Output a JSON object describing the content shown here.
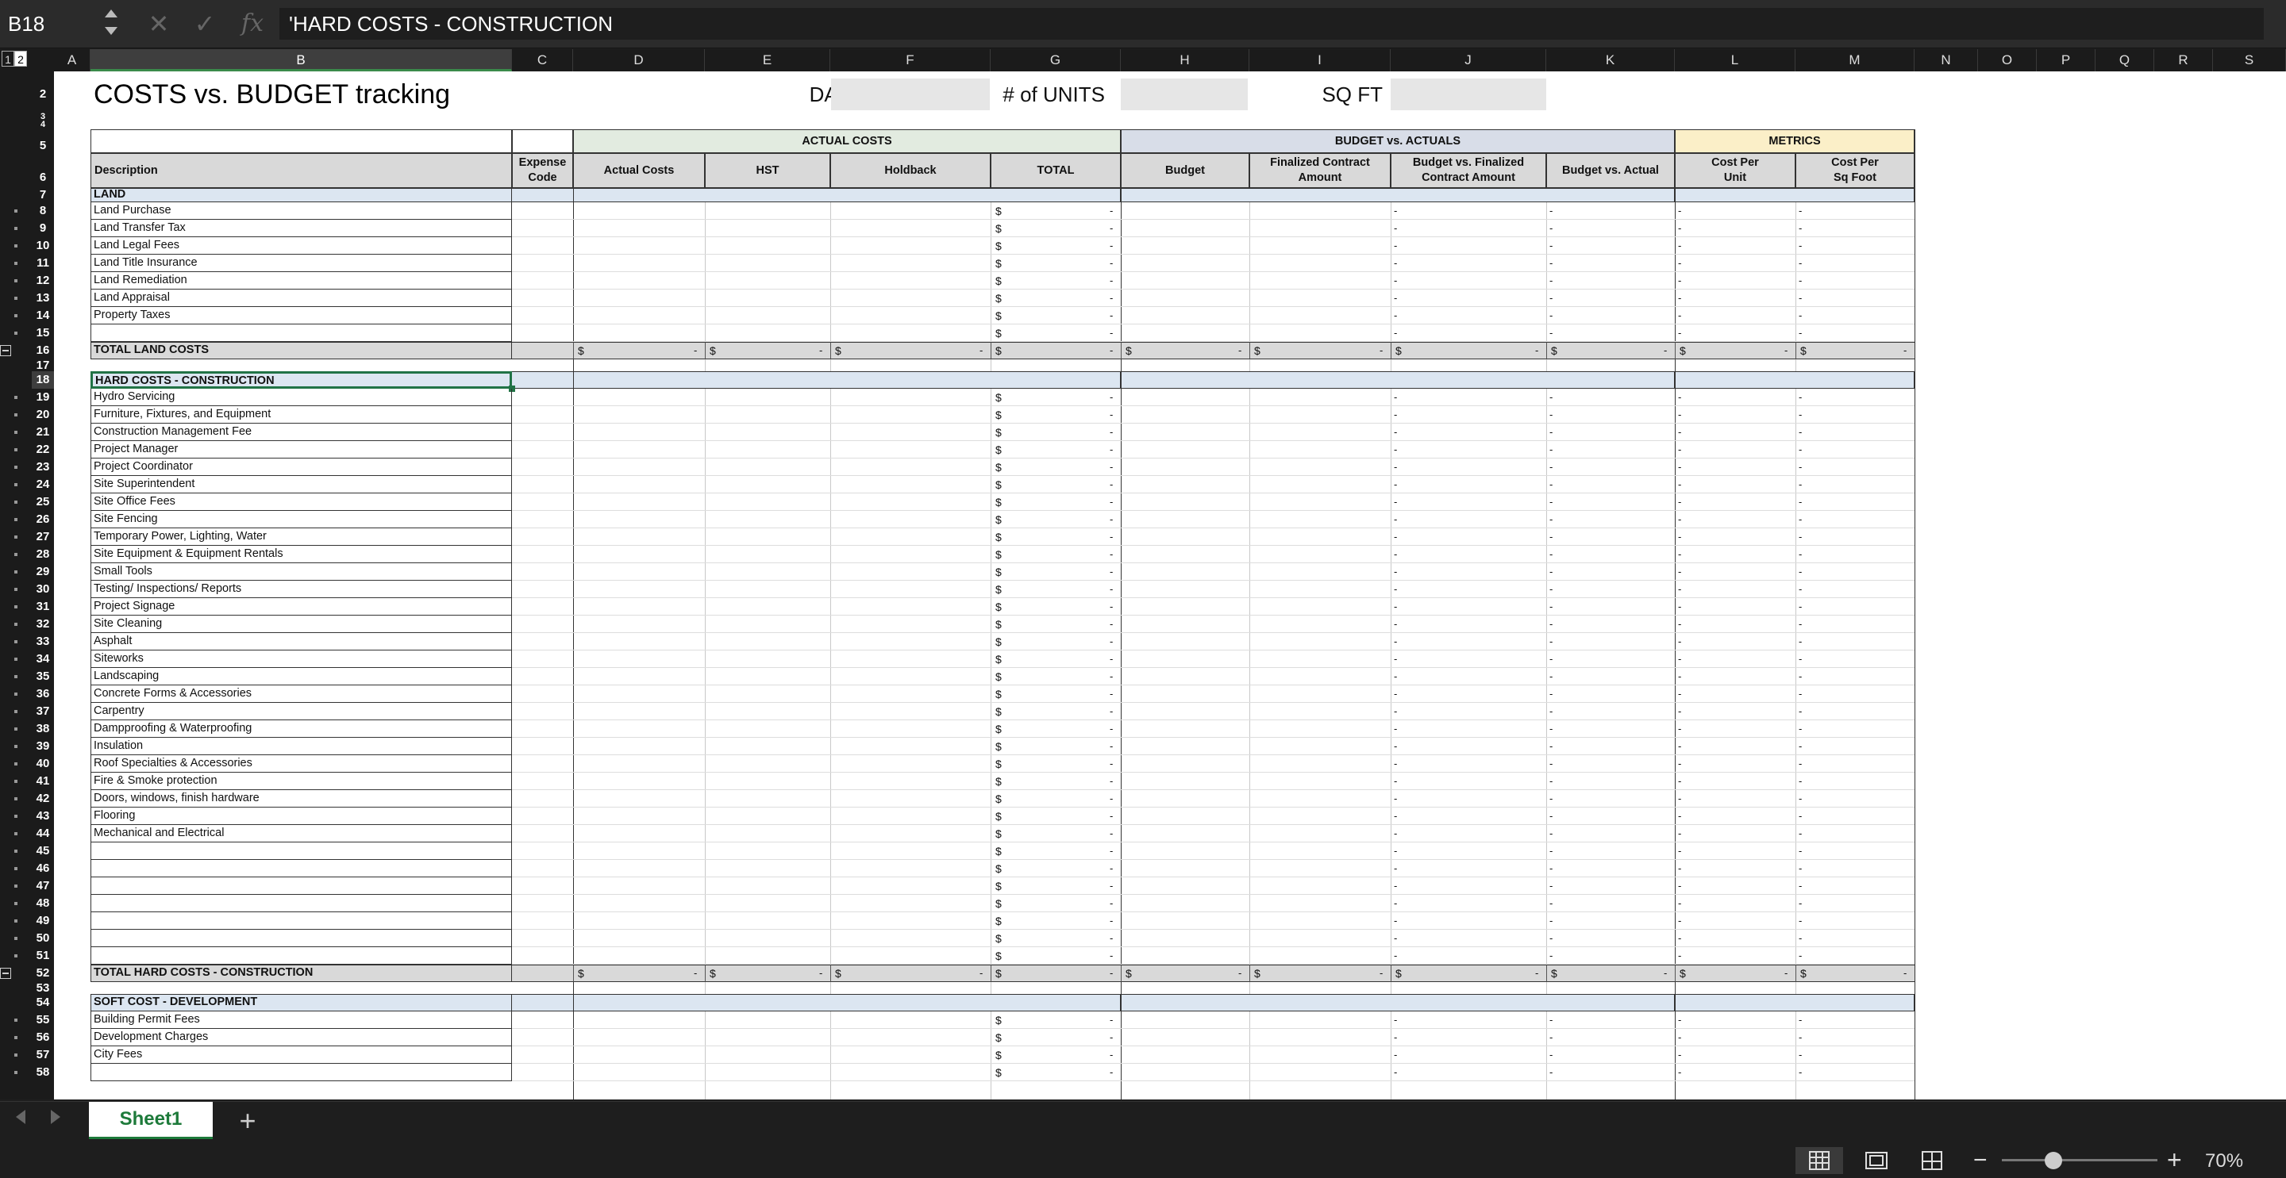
{
  "formula_bar": {
    "name_box": "B18",
    "formula": "'HARD COSTS - CONSTRUCTION",
    "fx": "fx",
    "cancel": "✕",
    "enter": "✓"
  },
  "outline_levels": [
    "1",
    "2"
  ],
  "columns": [
    "A",
    "B",
    "C",
    "D",
    "E",
    "F",
    "G",
    "H",
    "I",
    "J",
    "K",
    "L",
    "M",
    "N",
    "O",
    "P",
    "Q",
    "R",
    "S"
  ],
  "selected_column": "B",
  "sheet": {
    "title": "COSTS vs. BUDGET tracking",
    "date_label": "DATE",
    "units_label": "# of UNITS",
    "sqft_label": "SQ FT",
    "group_headers": {
      "actual": "ACTUAL COSTS",
      "budget": "BUDGET vs. ACTUALS",
      "metrics": "METRICS"
    },
    "col_headers": {
      "desc": "Description",
      "expense_code": [
        "Expense",
        "Code"
      ],
      "actual_costs": "Actual Costs",
      "hst": "HST",
      "holdback": "Holdback",
      "total": "TOTAL",
      "budget": "Budget",
      "finalized": [
        "Finalized Contract",
        "Amount"
      ],
      "bvf": [
        "Budget vs. Finalized",
        "Contract Amount"
      ],
      "bva": "Budget vs. Actual",
      "cpu": [
        "Cost Per",
        "Unit"
      ],
      "cps": [
        "Cost Per",
        "Sq Foot"
      ]
    },
    "currency": "$",
    "dash": "-",
    "land": {
      "title": "LAND",
      "items": [
        "Land Purchase",
        "Land Transfer Tax",
        "Land Legal Fees",
        "Land Title Insurance",
        "Land Remediation",
        "Land Appraisal",
        "Property Taxes",
        ""
      ],
      "total_label": "TOTAL LAND COSTS"
    },
    "hard": {
      "title": "HARD COSTS - CONSTRUCTION",
      "items": [
        "Hydro Servicing",
        "Furniture, Fixtures, and Equipment",
        "Construction Management Fee",
        "Project Manager",
        "Project Coordinator",
        "Site Superintendent",
        "Site Office Fees",
        "Site Fencing",
        "Temporary Power, Lighting, Water",
        "Site Equipment & Equipment Rentals",
        "Small Tools",
        "Testing/ Inspections/ Reports",
        "Project Signage",
        "Site Cleaning",
        "Asphalt",
        "Siteworks",
        "Landscaping",
        "Concrete Forms & Accessories",
        "Carpentry",
        "Dampproofing & Waterproofing",
        "Insulation",
        "Roof Specialties & Accessories",
        "Fire & Smoke protection",
        "Doors, windows, finish hardware",
        "Flooring",
        "Mechanical and Electrical",
        "",
        "",
        "",
        "",
        "",
        "",
        ""
      ],
      "total_label": "TOTAL HARD COSTS - CONSTRUCTION"
    },
    "soft": {
      "title": "SOFT COST - DEVELOPMENT",
      "items": [
        "Building Permit Fees",
        "Development Charges",
        "City Fees",
        ""
      ]
    }
  },
  "tabs": {
    "sheet_name": "Sheet1",
    "add": "+"
  },
  "status": {
    "zoom_level": "70%",
    "zoom_out": "−",
    "zoom_in": "+"
  }
}
